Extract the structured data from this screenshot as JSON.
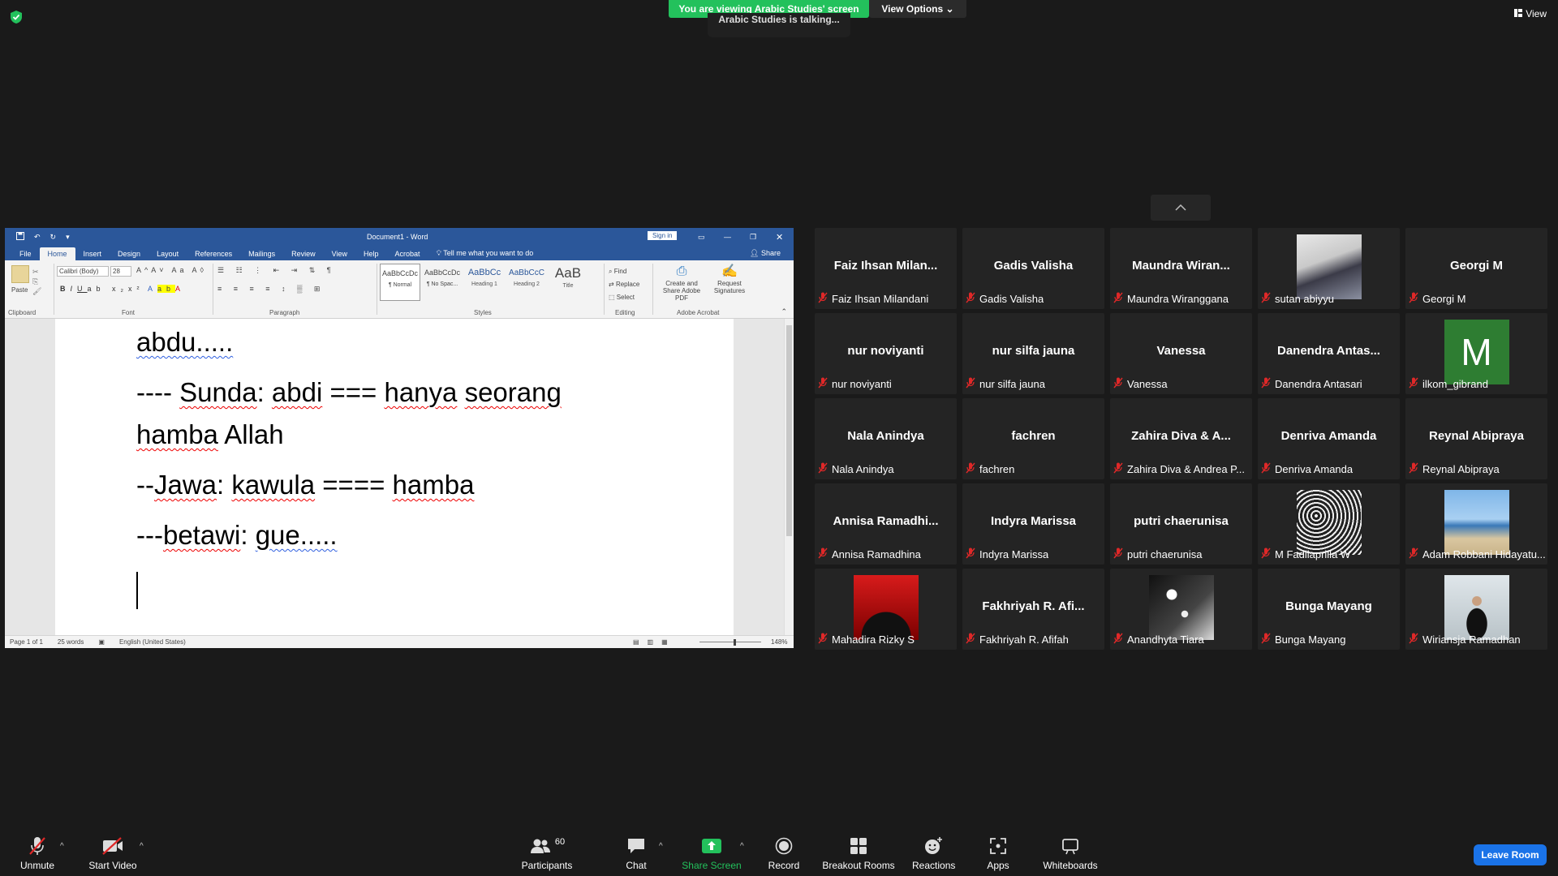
{
  "top": {
    "banner": "You are viewing Arabic Studies' screen",
    "view_options": "View Options",
    "talking": "Arabic Studies is talking...",
    "view_label": "View"
  },
  "word": {
    "title": "Document1 - Word",
    "sign_in": "Sign in",
    "tabs": [
      "File",
      "Home",
      "Insert",
      "Design",
      "Layout",
      "References",
      "Mailings",
      "Review",
      "View",
      "Help",
      "Acrobat"
    ],
    "tell_me": "Tell me what you want to do",
    "share": "Share",
    "font_name": "Calibri (Body)",
    "font_size": "28",
    "paste": "Paste",
    "groups": {
      "clipboard": "Clipboard",
      "font": "Font",
      "paragraph": "Paragraph",
      "styles": "Styles",
      "editing": "Editing",
      "adobe": "Adobe Acrobat"
    },
    "styles": [
      {
        "preview": "AaBbCcDc",
        "name": "¶ Normal"
      },
      {
        "preview": "AaBbCcDc",
        "name": "¶ No Spac..."
      },
      {
        "preview": "AaBbCc",
        "name": "Heading 1"
      },
      {
        "preview": "AaBbCcC",
        "name": "Heading 2"
      },
      {
        "preview": "AaB",
        "name": "Title"
      }
    ],
    "editing": {
      "find": "Find",
      "replace": "Replace",
      "select": "Select"
    },
    "adobe": {
      "create": "Create and Share Adobe PDF",
      "request": "Request Signatures"
    },
    "doc": {
      "line1": "abdu.....",
      "line2a": "---- ",
      "line2_sunda": "Sunda",
      "line2b": ": ",
      "line2_abdi": "abdi",
      "line2c": " === ",
      "line2_hanya": "hanya",
      "line2d": " ",
      "line2_seorang": "seorang",
      "line3_hamba": "hamba",
      "line3b": " Allah",
      "line4a": "--",
      "line4_jawa": "Jawa",
      "line4b": ": ",
      "line4_kawula": "kawula",
      "line4c": " ==== ",
      "line4_hamba": "hamba",
      "line5a": "---",
      "line5_betawi": "betawi",
      "line5b": ": ",
      "line5_gue": "gue....."
    },
    "status": {
      "page": "Page 1 of 1",
      "words": "25 words",
      "language": "English (United States)",
      "zoom": "148%"
    }
  },
  "participants_grid": [
    {
      "name": "Faiz Ihsan Milan...",
      "label": "Faiz Ihsan Milandani",
      "photo": ""
    },
    {
      "name": "Gadis Valisha",
      "label": "Gadis Valisha",
      "photo": ""
    },
    {
      "name": "Maundra Wiran...",
      "label": "Maundra Wiranggana",
      "photo": ""
    },
    {
      "name": "",
      "label": "sutan abiyyu",
      "photo": "hoodie"
    },
    {
      "name": "Georgi M",
      "label": "Georgi M",
      "photo": ""
    },
    {
      "name": "nur noviyanti",
      "label": "nur noviyanti",
      "photo": ""
    },
    {
      "name": "nur silfa jauna",
      "label": "nur silfa jauna",
      "photo": ""
    },
    {
      "name": "Vanessa",
      "label": "Vanessa",
      "photo": ""
    },
    {
      "name": "Danendra Antas...",
      "label": "Danendra Antasari",
      "photo": ""
    },
    {
      "name": "",
      "label": "ilkom_gibrand",
      "photo": "letter"
    },
    {
      "name": "Nala Anindya",
      "label": "Nala Anindya",
      "photo": ""
    },
    {
      "name": "fachren",
      "label": "fachren",
      "photo": ""
    },
    {
      "name": "Zahira Diva & A...",
      "label": "Zahira Diva & Andrea P...",
      "photo": ""
    },
    {
      "name": "Denriva Amanda",
      "label": "Denriva Amanda",
      "photo": ""
    },
    {
      "name": "Reynal Abipraya",
      "label": "Reynal Abipraya",
      "photo": ""
    },
    {
      "name": "Annisa Ramadhi...",
      "label": "Annisa Ramadhina",
      "photo": ""
    },
    {
      "name": "Indyra Marissa",
      "label": "Indyra Marissa",
      "photo": ""
    },
    {
      "name": "putri chaerunisa",
      "label": "putri chaerunisa",
      "photo": ""
    },
    {
      "name": "",
      "label": "M Fadilaprilla W",
      "photo": "noise"
    },
    {
      "name": "",
      "label": "Adam Robbani Hidayatu...",
      "photo": "beach"
    },
    {
      "name": "",
      "label": "Mahadira Rizky S",
      "photo": "red"
    },
    {
      "name": "Fakhriyah R. Afi...",
      "label": "Fakhriyah R. Afifah",
      "photo": ""
    },
    {
      "name": "",
      "label": "Anandhyta Tiara",
      "photo": "bw"
    },
    {
      "name": "Bunga Mayang",
      "label": "Bunga Mayang",
      "photo": ""
    },
    {
      "name": "",
      "label": "Wiriansja Ramadhan",
      "photo": "portrait"
    }
  ],
  "avatar_letter": "M",
  "avatar_color": "#2e7d32",
  "toolbar": {
    "unmute": "Unmute",
    "start_video": "Start Video",
    "participants": "Participants",
    "participants_count": "60",
    "chat": "Chat",
    "share_screen": "Share Screen",
    "record": "Record",
    "breakout": "Breakout Rooms",
    "reactions": "Reactions",
    "apps": "Apps",
    "whiteboards": "Whiteboards",
    "leave": "Leave Room"
  },
  "colors": {
    "banner_green": "#23c15c",
    "word_blue": "#2b579a",
    "share_green": "#23c15c",
    "leave_blue": "#1a73e8",
    "mic_off_red": "#e02828"
  }
}
